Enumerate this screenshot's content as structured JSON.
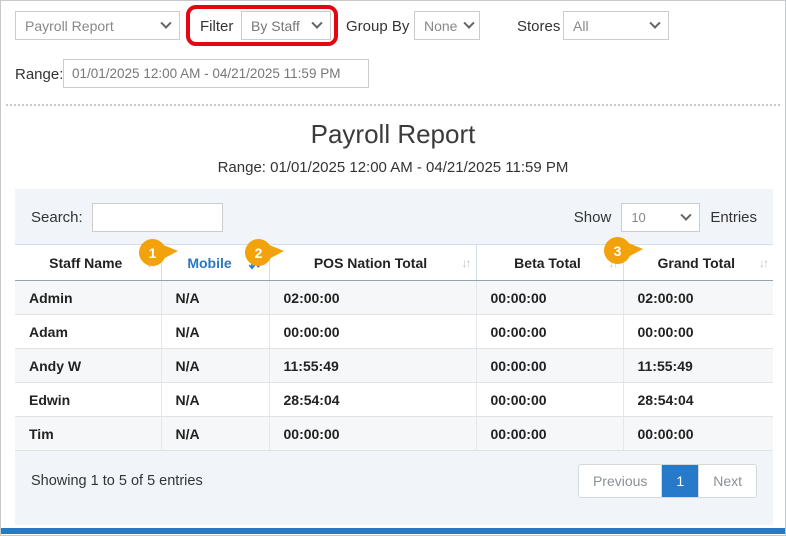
{
  "toolbar": {
    "report_type": {
      "value": "Payroll Report"
    },
    "filter": {
      "label": "Filter",
      "value": "By Staff"
    },
    "group_by": {
      "label": "Group By",
      "value": "None"
    },
    "stores": {
      "label": "Stores",
      "value": "All"
    }
  },
  "range_bar": {
    "label": "Range:",
    "value": "01/01/2025 12:00 AM - 04/21/2025 11:59 PM"
  },
  "report_header": {
    "title": "Payroll Report",
    "subtitle": "Range: 01/01/2025 12:00 AM - 04/21/2025 11:59 PM"
  },
  "controls": {
    "search_label": "Search:",
    "search_value": "",
    "show_label": "Show",
    "page_size": "10",
    "entries_label": "Entries"
  },
  "annotations": {
    "badges": [
      "1",
      "2",
      "3"
    ],
    "badge_color": "#f2a30b",
    "highlight_red": "#e40613"
  },
  "table": {
    "columns": [
      {
        "label": "Staff Name",
        "sort": "unsorted"
      },
      {
        "label": "Mobile",
        "sort": "descending"
      },
      {
        "label": "POS Nation Total",
        "sort": "unsorted"
      },
      {
        "label": "Beta Total",
        "sort": "unsorted"
      },
      {
        "label": "Grand Total",
        "sort": "unsorted"
      }
    ],
    "rows": [
      {
        "cells": [
          "Admin",
          "N/A",
          "02:00:00",
          "00:00:00",
          "02:00:00"
        ]
      },
      {
        "cells": [
          "Adam",
          "N/A",
          "00:00:00",
          "00:00:00",
          "00:00:00"
        ]
      },
      {
        "cells": [
          "Andy W",
          "N/A",
          "11:55:49",
          "00:00:00",
          "11:55:49"
        ]
      },
      {
        "cells": [
          "Edwin",
          "N/A",
          "28:54:04",
          "00:00:00",
          "28:54:04"
        ]
      },
      {
        "cells": [
          "Tim",
          "N/A",
          "00:00:00",
          "00:00:00",
          "00:00:00"
        ]
      }
    ]
  },
  "footer": {
    "status": "Showing 1 to 5 of 5 entries",
    "pagination": {
      "previous": "Previous",
      "page": "1",
      "next": "Next"
    }
  },
  "colors": {
    "sorted_column_blue": "#2878c8",
    "pagination_active_blue": "#2779c9",
    "bottom_bar_blue": "#2878c8",
    "badge_orange": "#f2a30b",
    "highlight_red": "#e40613"
  }
}
